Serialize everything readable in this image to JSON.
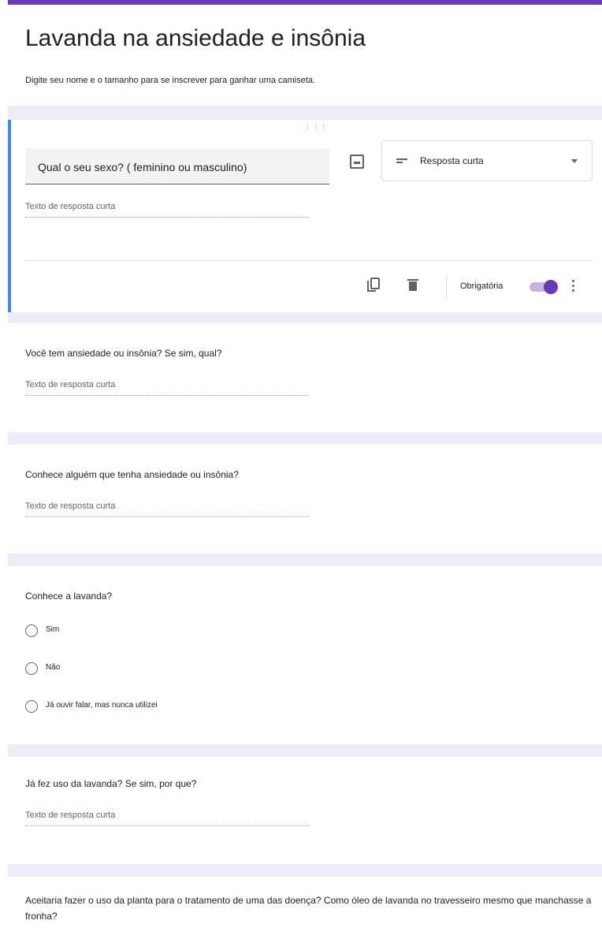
{
  "form": {
    "title": "Lavanda na ansiedade e insônia",
    "description": "Digite seu nome e o tamanho para se inscrever para ganhar uma camiseta."
  },
  "active_question": {
    "title": "Qual o seu sexo? ( feminino ou masculino)",
    "type_label": "Resposta curta",
    "placeholder": "Texto de resposta curta",
    "required_label": "Obrigatória",
    "required": true,
    "icons": [
      "drag-handle-icon",
      "image-icon",
      "short-answer-icon",
      "chevron-down-icon",
      "duplicate-icon",
      "trash-icon",
      "more-vert-icon"
    ],
    "accent_color": "#673ab7",
    "border_color": "#4285f4"
  },
  "questions": [
    {
      "title": "Você tem ansiedade ou insônia? Se sim, qual?",
      "placeholder": "Texto de resposta curta"
    },
    {
      "title": "Conhece alguém que tenha ansiedade ou insônia?",
      "placeholder": "Texto de resposta curta"
    },
    {
      "title": "Conhece a lavanda?",
      "options": [
        "Sim",
        "Não",
        "Já ouvir falar, mas nunca utilizei"
      ]
    },
    {
      "title": "Já fez uso da lavanda? Se sim, por que?",
      "placeholder": "Texto de resposta curta"
    },
    {
      "title": "Aceitaria fazer o uso da planta para o tratamento de uma das doença? Como óleo de lavanda no travesseiro mesmo que manchasse a fronha?"
    }
  ],
  "colors": {
    "theme": "#673ab7",
    "separator": "#f0ebf8"
  }
}
